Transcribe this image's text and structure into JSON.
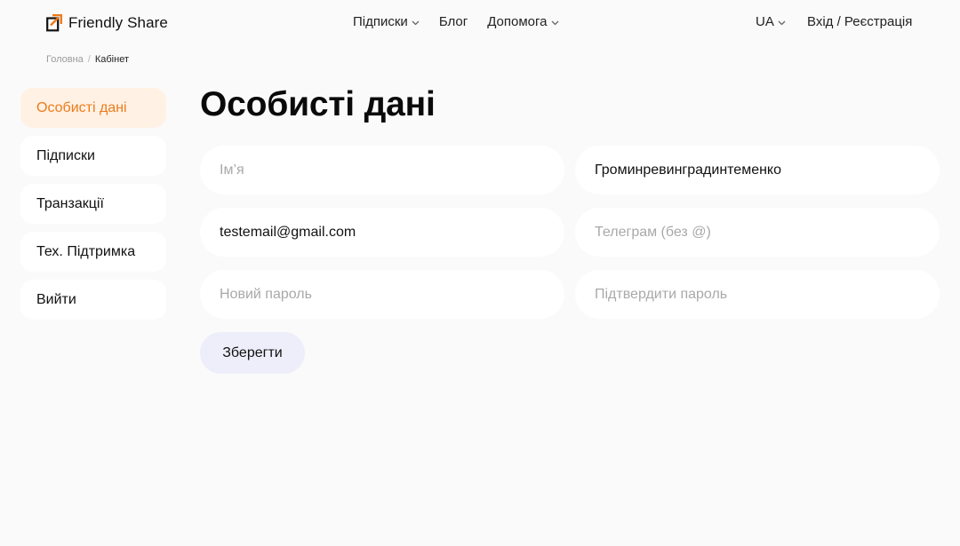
{
  "header": {
    "brand": "Friendly Share",
    "nav": [
      {
        "label": "Підписки",
        "has_dropdown": true
      },
      {
        "label": "Блог",
        "has_dropdown": false
      },
      {
        "label": "Допомога",
        "has_dropdown": true
      }
    ],
    "language": "UA",
    "auth_link": "Вхід / Реєстрація"
  },
  "breadcrumb": {
    "home": "Головна",
    "separator": "/",
    "current": "Кабінет"
  },
  "sidebar": {
    "items": [
      {
        "label": "Особисті дані",
        "active": true
      },
      {
        "label": "Підписки",
        "active": false
      },
      {
        "label": "Транзакції",
        "active": false
      },
      {
        "label": "Тех. Підтримка",
        "active": false
      },
      {
        "label": "Вийти",
        "active": false
      }
    ]
  },
  "main": {
    "title": "Особисті дані",
    "form": {
      "first_name": {
        "value": "",
        "placeholder": "Ім’я"
      },
      "last_name": {
        "value": "Громинревинградинтеменко",
        "placeholder": ""
      },
      "email": {
        "value": "testemail@gmail.com",
        "placeholder": ""
      },
      "telegram": {
        "value": "",
        "placeholder": "Телеграм (без @)"
      },
      "new_password": {
        "value": "",
        "placeholder": "Новий пароль"
      },
      "confirm_password": {
        "value": "",
        "placeholder": "Підтвердити пароль"
      }
    },
    "save_label": "Зберегти"
  },
  "colors": {
    "accent": "#ee7b1a",
    "active_bg": "#fff1e4",
    "button_bg": "#eeeefb",
    "page_bg": "#fafafa"
  },
  "icons": [
    "logo-icon",
    "chevron-down-icon"
  ]
}
